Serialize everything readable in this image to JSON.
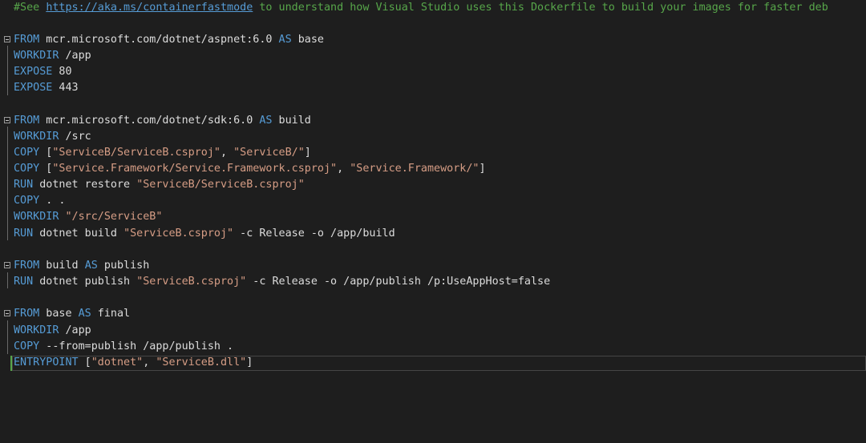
{
  "comment": {
    "prefix": "#See ",
    "link": "https://aka.ms/containerfastmode",
    "suffix": " to understand how Visual Studio uses this Dockerfile to build your images for faster deb"
  },
  "stage_base": {
    "from_kw": "FROM",
    "from_image": " mcr.microsoft.com/dotnet/aspnet:6.0 ",
    "as_kw": "AS",
    "stage_name": " base",
    "workdir_kw": "WORKDIR",
    "workdir_val": " /app",
    "expose1_kw": "EXPOSE",
    "expose1_val": " 80",
    "expose2_kw": "EXPOSE",
    "expose2_val": " 443"
  },
  "stage_build": {
    "from_kw": "FROM",
    "from_image": " mcr.microsoft.com/dotnet/sdk:6.0 ",
    "as_kw": "AS",
    "stage_name": " build",
    "workdir_kw": "WORKDIR",
    "workdir_val": " /src",
    "copy1_kw": "COPY",
    "copy1_open": " [",
    "copy1_src": "\"ServiceB/ServiceB.csproj\"",
    "copy1_sep": ", ",
    "copy1_dst": "\"ServiceB/\"",
    "copy1_close": "]",
    "copy2_kw": "COPY",
    "copy2_open": " [",
    "copy2_src": "\"Service.Framework/Service.Framework.csproj\"",
    "copy2_sep": ", ",
    "copy2_dst": "\"Service.Framework/\"",
    "copy2_close": "]",
    "run1_kw": "RUN",
    "run1_cmd": " dotnet restore ",
    "run1_arg": "\"ServiceB/ServiceB.csproj\"",
    "copy3_kw": "COPY",
    "copy3_val": " . .",
    "workdir2_kw": "WORKDIR",
    "workdir2_val": "\"/src/ServiceB\"",
    "run2_kw": "RUN",
    "run2_cmd": " dotnet build ",
    "run2_arg": "\"ServiceB.csproj\"",
    "run2_rest": " -c Release -o /app/build"
  },
  "stage_publish": {
    "from_kw": "FROM",
    "from_image": " build ",
    "as_kw": "AS",
    "stage_name": " publish",
    "run_kw": "RUN",
    "run_cmd": " dotnet publish ",
    "run_arg": "\"ServiceB.csproj\"",
    "run_rest": " -c Release -o /app/publish /p:UseAppHost=false"
  },
  "stage_final": {
    "from_kw": "FROM",
    "from_image": " base ",
    "as_kw": "AS",
    "stage_name": " final",
    "workdir_kw": "WORKDIR",
    "workdir_val": " /app",
    "copy_kw": "COPY",
    "copy_val": " --from=publish /app/publish .",
    "entry_kw": "ENTRYPOINT",
    "entry_open": " [",
    "entry_arg1": "\"dotnet\"",
    "entry_sep": ", ",
    "entry_arg2": "\"ServiceB.dll\"",
    "entry_close": "]"
  },
  "colors": {
    "background": "#1e1e1e",
    "keyword": "#569cd6",
    "string": "#d69d85",
    "comment": "#57a64a",
    "text": "#dcdcdc"
  }
}
